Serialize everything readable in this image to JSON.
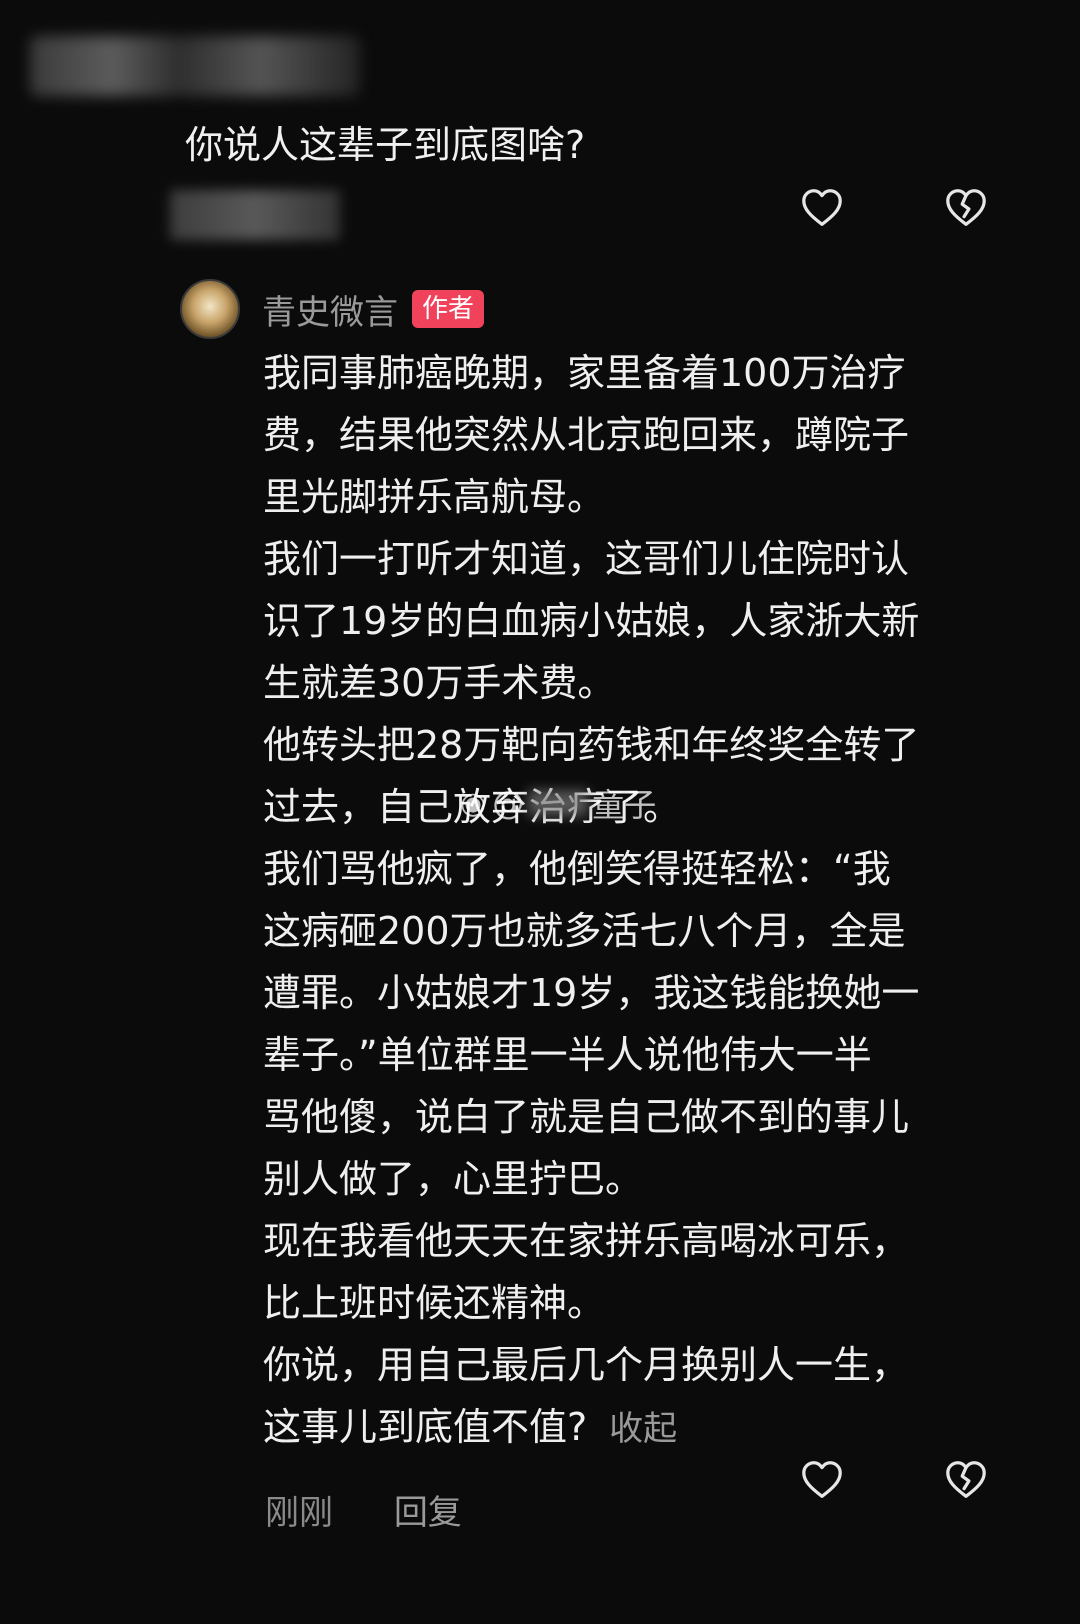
{
  "top_comment": {
    "text": "你说人这辈子到底图啥?"
  },
  "reply": {
    "author": "青史微言",
    "badge": "作者",
    "lines": [
      "我同事肺癌晚期，家里备着100万治疗",
      "费，结果他突然从北京跑回来，蹲院子",
      "里光脚拼乐高航母。",
      "我们一打听才知道，这哥们儿住院时认",
      "识了19岁的白血病小姑娘，人家浙大新",
      "生就差30万手术费。",
      "他转头把28万靶向药钱和年终奖全转了",
      "过去，自己放弃治疗了。",
      "我们骂他疯了，他倒笑得挺轻松：“我",
      "这病砸200万也就多活七八个月，全是",
      "遭罪。小姑娘才19岁，我这钱能换她一",
      "辈子。”单位群里一半人说他伟大一半",
      "骂他傻，说白了就是自己做不到的事儿",
      "别人做了，心里拧巴。",
      "现在我看他天天在家拼乐高喝冰可乐，",
      "比上班时候还精神。",
      "你说，用自己最后几个月换别人一生，",
      "这事儿到底值不值?"
    ],
    "collapse": "收起",
    "time": "刚刚",
    "reply_action": "回复"
  },
  "watermark": {
    "at": "@",
    "suffix": "童子"
  },
  "icons": {
    "like": "heart-outline-icon",
    "dislike": "broken-heart-icon"
  },
  "colors": {
    "background": "#0b0b0b",
    "badge": "#f0435b",
    "secondary_text": "#9a9a9a"
  }
}
